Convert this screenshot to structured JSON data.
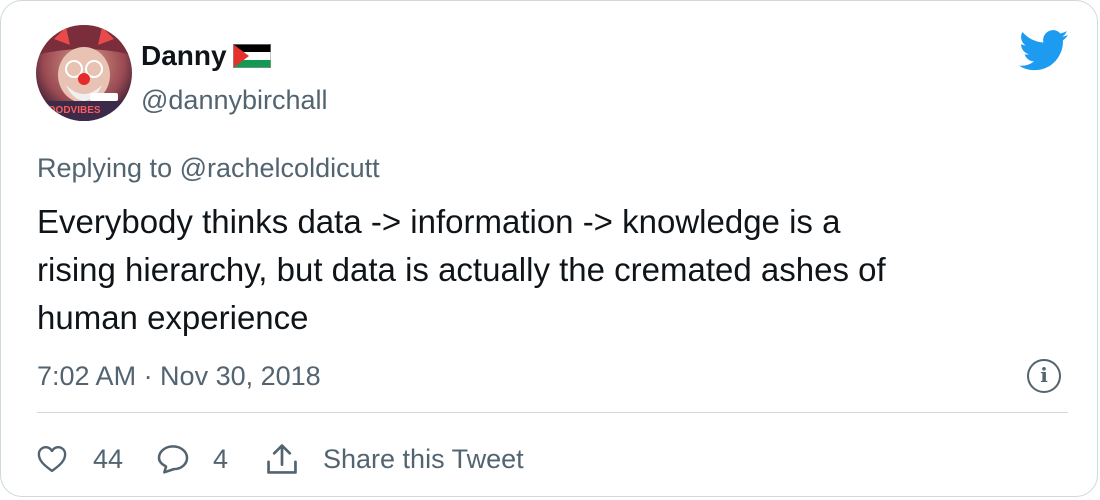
{
  "author": {
    "display_name": "Danny",
    "handle": "@dannybirchall",
    "avatar_text": "GOODVIBES",
    "flag": "palestine-flag-icon"
  },
  "platform_icon": "twitter-bird-icon",
  "reply_context": {
    "prefix": "Replying to",
    "user": "@rachelcoldicutt"
  },
  "tweet": {
    "text": "Everybody thinks data -> information -> knowledge is a\nrising hierarchy, but data is actually the cremated ashes of\nhuman experience",
    "timestamp": "7:02 AM · Nov 30, 2018"
  },
  "actions": {
    "likes": "44",
    "replies": "4",
    "share_label": "Share this Tweet"
  },
  "colors": {
    "text": "#0f1419",
    "secondary": "#536471",
    "twitter_blue": "#1d9bf0",
    "border": "#cfd9de"
  }
}
